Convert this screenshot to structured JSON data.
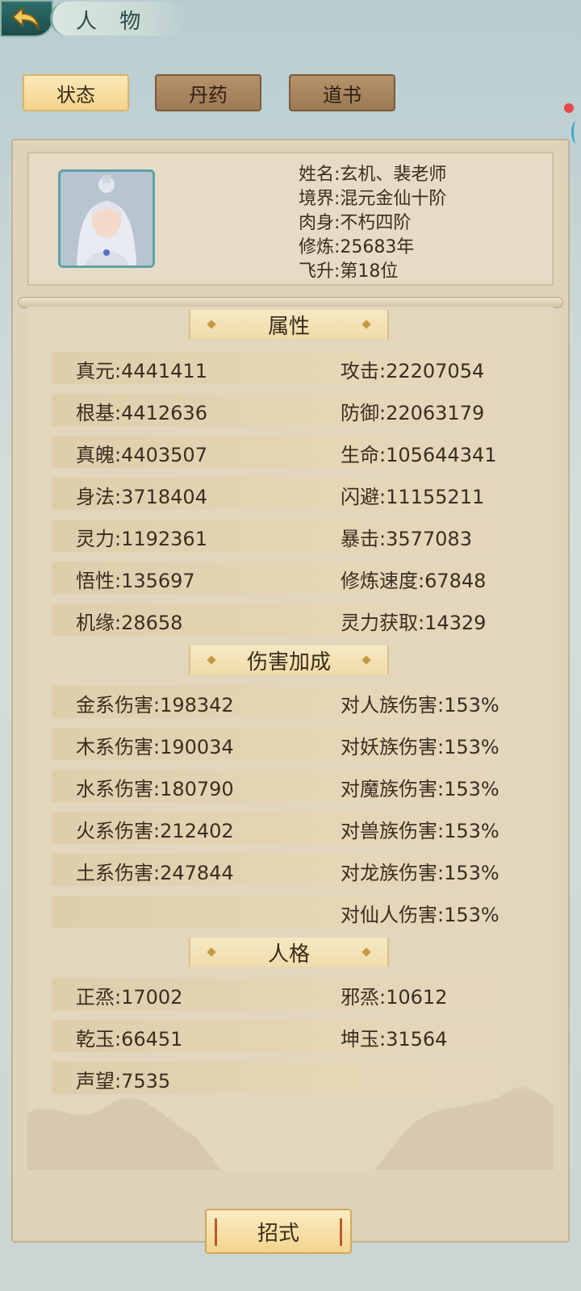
{
  "header": {
    "title": "人 物",
    "back_icon": "back-arrow-icon"
  },
  "tabs": [
    {
      "label": "状态",
      "active": true
    },
    {
      "label": "丹药",
      "active": false
    },
    {
      "label": "道书",
      "active": false
    }
  ],
  "profile": {
    "lines": [
      "姓名:玄机、裴老师",
      "境界:混元金仙十阶",
      "肉身:不朽四阶",
      "修炼:25683年",
      "飞升:第18位"
    ]
  },
  "sections": {
    "attributes": {
      "title": "属性",
      "rows": [
        [
          "真元:4441411",
          "攻击:22207054"
        ],
        [
          "根基:4412636",
          "防御:22063179"
        ],
        [
          "真魄:4403507",
          "生命:105644341"
        ],
        [
          "身法:3718404",
          "闪避:11155211"
        ],
        [
          "灵力:1192361",
          "暴击:3577083"
        ],
        [
          "悟性:135697",
          "修炼速度:67848"
        ],
        [
          "机缘:28658",
          "灵力获取:14329"
        ]
      ]
    },
    "damage": {
      "title": "伤害加成",
      "rows": [
        [
          "金系伤害:198342",
          "对人族伤害:153%"
        ],
        [
          "木系伤害:190034",
          "对妖族伤害:153%"
        ],
        [
          "水系伤害:180790",
          "对魔族伤害:153%"
        ],
        [
          "火系伤害:212402",
          "对兽族伤害:153%"
        ],
        [
          "土系伤害:247844",
          "对龙族伤害:153%"
        ],
        [
          "",
          "对仙人伤害:153%"
        ]
      ]
    },
    "personality": {
      "title": "人格",
      "rows": [
        [
          "正烝:17002",
          "邪烝:10612"
        ],
        [
          "乾玉:66451",
          "坤玉:31564"
        ],
        [
          "声望:7535",
          ""
        ]
      ]
    }
  },
  "bottom_button": {
    "label": "招式"
  },
  "colors": {
    "accent": "#f3d38a",
    "panel": "#ded3bb",
    "text": "#3b2e20"
  }
}
